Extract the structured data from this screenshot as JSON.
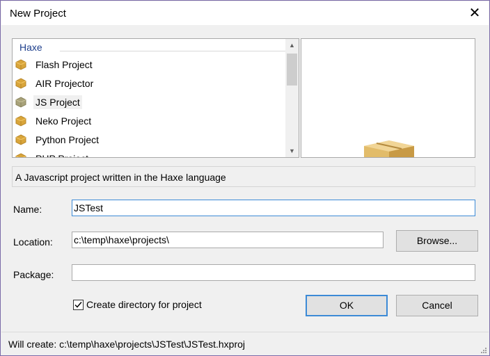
{
  "window": {
    "title": "New Project",
    "close_glyph": "✕"
  },
  "templates": {
    "group": "Haxe",
    "items": [
      {
        "label": "Flash Project",
        "icon": "package-icon",
        "color": "#d9a53a"
      },
      {
        "label": "AIR Projector",
        "icon": "package-icon",
        "color": "#d9a53a"
      },
      {
        "label": "JS Project",
        "icon": "package-icon",
        "color": "#a8a27a",
        "selected": true
      },
      {
        "label": "Neko Project",
        "icon": "package-icon",
        "color": "#d9a53a"
      },
      {
        "label": "Python Project",
        "icon": "package-icon",
        "color": "#d9a53a"
      },
      {
        "label": "PHP Project",
        "icon": "package-icon",
        "color": "#d9a53a"
      }
    ]
  },
  "description": "A Javascript project written in the Haxe language",
  "form": {
    "name_label": "Name:",
    "name_value": "JSTest",
    "location_label": "Location:",
    "location_value": "c:\\temp\\haxe\\projects\\",
    "browse_label": "Browse...",
    "package_label": "Package:",
    "package_value": "",
    "create_dir_label": "Create directory for project",
    "create_dir_checked": true
  },
  "buttons": {
    "ok": "OK",
    "cancel": "Cancel"
  },
  "status": "Will create: c:\\temp\\haxe\\projects\\JSTest\\JSTest.hxproj",
  "colors": {
    "accent": "#3c8ad6",
    "group_header": "#1e3f8c",
    "icon_gold": "#d9a53a",
    "icon_muted": "#a8a27a"
  }
}
